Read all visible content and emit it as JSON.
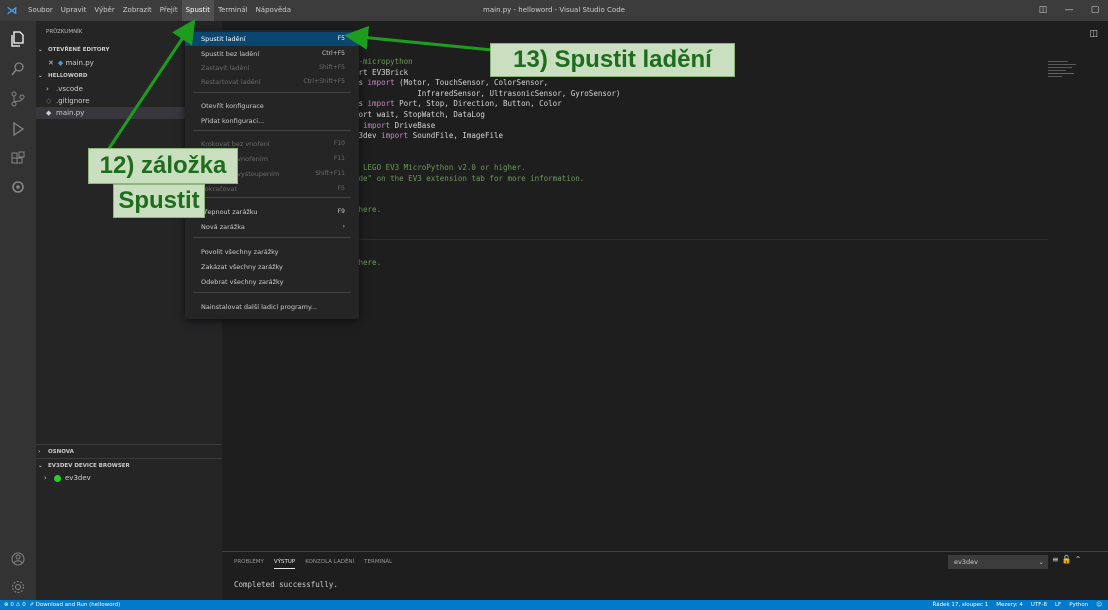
{
  "window": {
    "title": "main.py - helloword - Visual Studio Code",
    "menu": [
      "Soubor",
      "Upravit",
      "Výběr",
      "Zobrazit",
      "Přejít",
      "Spustit",
      "Terminál",
      "Nápověda"
    ]
  },
  "sidebar": {
    "header": "PRŮZKUMNÍK",
    "open_editors_title": "OTEVŘENÉ EDITORY",
    "open_editor_file": "main.py",
    "project_title": "HELLOWORD",
    "files": [
      ".vscode",
      ".gitignore",
      "main.py"
    ],
    "outline_title": "OSNOVA",
    "device_browser_title": "EV3DEV DEVICE BROWSER",
    "device_name": "ev3dev"
  },
  "editor": {
    "code_lines": [
      [
        {
          "t": "s-micropython",
          "c": "s"
        }
      ],
      [
        {
          "t": "ort EV3Brick",
          "c": ""
        }
      ],
      [
        {
          "t": "es ",
          "c": ""
        },
        {
          "t": "import",
          "c": "k"
        },
        {
          "t": " (Motor, TouchSensor, ColorSensor,",
          "c": ""
        }
      ],
      [
        {
          "t": "              InfraredSensor, UltrasonicSensor, GyroSensor)",
          "c": ""
        }
      ],
      [
        {
          "t": "rs ",
          "c": ""
        },
        {
          "t": "import",
          "c": "k"
        },
        {
          "t": " Port, Stop, Direction, Button, Color",
          "c": ""
        }
      ],
      [
        {
          "t": "port wait, StopWatch, DataLog",
          "c": ""
        }
      ],
      [
        {
          "t": "s ",
          "c": ""
        },
        {
          "t": "import",
          "c": "k"
        },
        {
          "t": " DriveBase",
          "c": ""
        }
      ],
      [
        {
          "t": "v3dev ",
          "c": ""
        },
        {
          "t": "import",
          "c": "k"
        },
        {
          "t": " SoundFile, ImageFile",
          "c": ""
        }
      ],
      [
        {
          "t": "",
          "c": ""
        }
      ],
      [
        {
          "t": "",
          "c": ""
        }
      ],
      [
        {
          "t": "s LEGO EV3 MicroPython v2.0 or higher.",
          "c": "s"
        }
      ],
      [
        {
          "t": "ide\" on the EV3 extension tab for more information.",
          "c": "s"
        }
      ],
      [
        {
          "t": "",
          "c": ""
        }
      ],
      [
        {
          "t": "",
          "c": ""
        }
      ],
      [
        {
          "t": " here.",
          "c": "s"
        }
      ],
      [
        {
          "t": "",
          "c": ""
        }
      ],
      [
        {
          "t": "",
          "c": ""
        }
      ],
      [
        {
          "t": "",
          "c": ""
        }
      ],
      [
        {
          "t": "",
          "c": ""
        }
      ],
      [
        {
          "t": " here.",
          "c": "s"
        }
      ]
    ]
  },
  "run_menu": {
    "items": [
      {
        "label": "Spustit ladění",
        "key": "F5",
        "state": "highlight"
      },
      {
        "label": "Spustit bez ladění",
        "key": "Ctrl+F5",
        "state": "normal"
      },
      {
        "label": "Zastavit ladění",
        "key": "Shift+F5",
        "state": "disabled"
      },
      {
        "label": "Restartovat ladění",
        "key": "Ctrl+Shift+F5",
        "state": "disabled"
      },
      {
        "label": "Otevřít konfigurace",
        "key": "",
        "state": "normal"
      },
      {
        "label": "Přidat konfiguraci...",
        "key": "",
        "state": "normal"
      },
      {
        "label": "Krokovat bez vnoření",
        "key": "F10",
        "state": "disabled"
      },
      {
        "label": "Krokovat s vnořením",
        "key": "F11",
        "state": "disabled"
      },
      {
        "label": "Krokovat s vystoupením",
        "key": "Shift+F11",
        "state": "disabled"
      },
      {
        "label": "Pokračovat",
        "key": "F5",
        "state": "disabled"
      },
      {
        "label": "Přepnout zarážku",
        "key": "F9",
        "state": "normal"
      },
      {
        "label": "Nová zarážka",
        "key": "›",
        "state": "normal"
      },
      {
        "label": "Povolit všechny zarážky",
        "key": "",
        "state": "normal"
      },
      {
        "label": "Zakázat všechny zarážky",
        "key": "",
        "state": "normal"
      },
      {
        "label": "Odebrat všechny zarážky",
        "key": "",
        "state": "normal"
      },
      {
        "label": "Nainstalovat další ladicí programy...",
        "key": "",
        "state": "normal"
      }
    ]
  },
  "panel": {
    "tabs": [
      "PROBLÉMY",
      "VÝSTUP",
      "KONZOLA LADĚNÍ",
      "TERMINÁL"
    ],
    "active_tab": "VÝSTUP",
    "output_channel": "ev3dev",
    "output_text": "Completed successfully."
  },
  "statusbar": {
    "problems": "⊗ 0 ⚠ 0",
    "run_task": "⇗ Download and Run (helloword)",
    "position": "Řádek 17, sloupec 1",
    "spaces": "Mezery: 4",
    "encoding": "UTF-8",
    "eol": "LF",
    "language": "Python"
  },
  "annotations": {
    "step13": "13) Spustit ladění",
    "step12_line1": "12) záložka",
    "step12_line2": "Spustit",
    "color": "#1e6c1e"
  }
}
